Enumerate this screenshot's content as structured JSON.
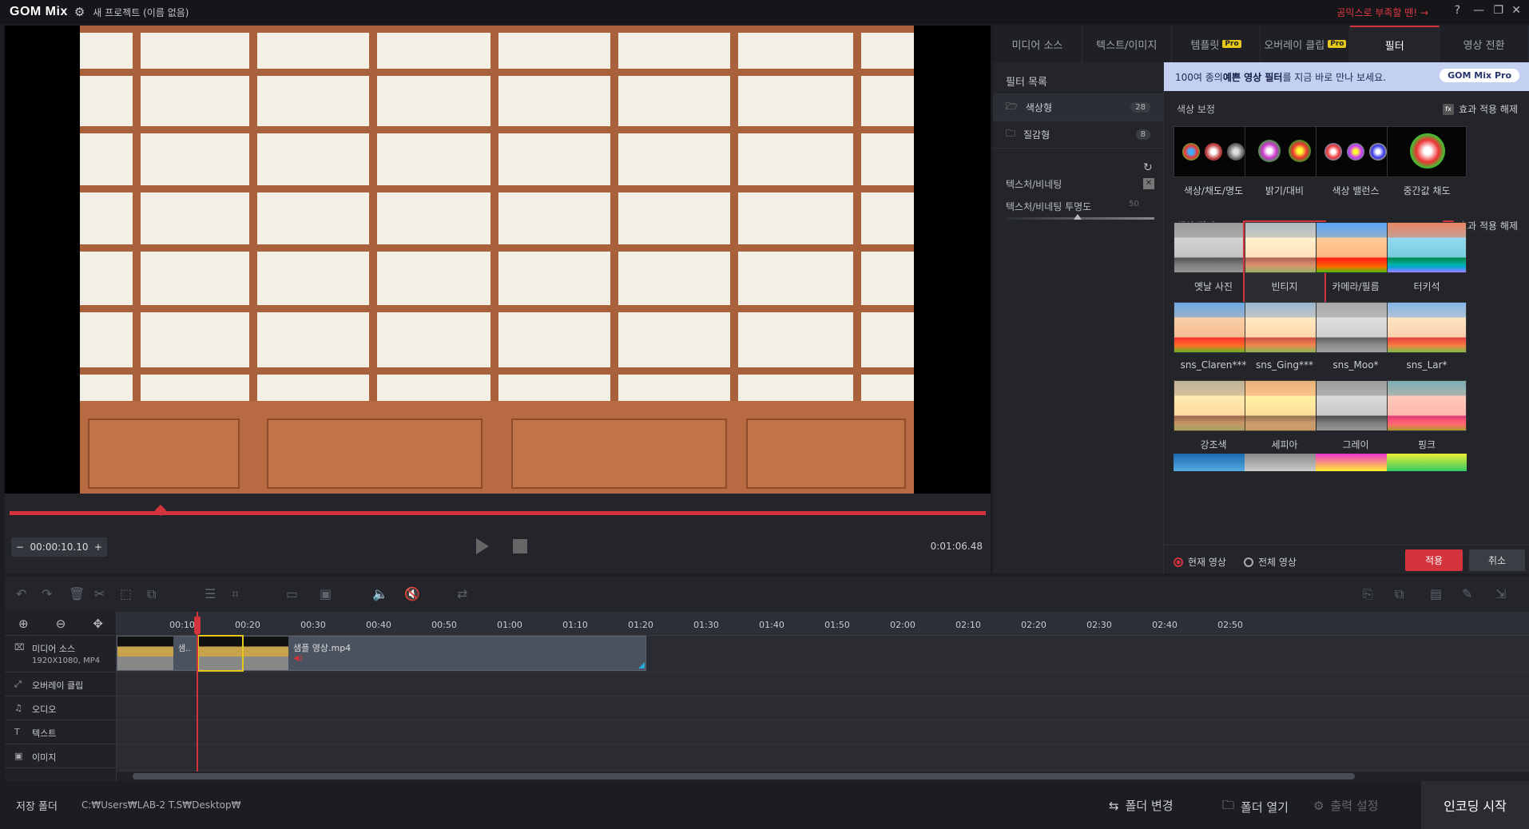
{
  "titlebar": {
    "logo": "GOM Mix",
    "project": "새 프로젝트 (이름 없음)",
    "promo": "곰믹스로 부족할 땐! →",
    "help": "?",
    "minimize": "—",
    "restore": "❐",
    "close": "✕"
  },
  "player": {
    "current_time": "00:00:10.10",
    "duration": "0:01:06.48",
    "progress": 0.155
  },
  "tabs": [
    {
      "label": "미디어 소스",
      "pro": ""
    },
    {
      "label": "텍스트/이미지",
      "pro": ""
    },
    {
      "label": "템플릿",
      "pro": "Pro"
    },
    {
      "label": "오버레이 클립",
      "pro": "Pro"
    },
    {
      "label": "필터",
      "pro": ""
    },
    {
      "label": "영상 전환",
      "pro": ""
    }
  ],
  "filter_list": {
    "header": "필터 목록",
    "categories": [
      {
        "label": "색상형",
        "count": "28"
      },
      {
        "label": "질감형",
        "count": "8"
      }
    ],
    "texture_label": "텍스처/비네팅",
    "texture_opacity_label": "텍스처/비네팅 투명도",
    "texture_opacity_value": "50"
  },
  "banner": {
    "pre": "100여 종의 ",
    "bold": "예쁜 영상 필터",
    "post": "를 지금 바로 만나 보세요.",
    "logo": "GOM Mix Pro"
  },
  "color_correction": {
    "title": "색상 보정",
    "reset": "효과 적용 해제",
    "items": [
      "색상/채도/명도",
      "밝기/대비",
      "색상 밸런스",
      "중간값 채도"
    ]
  },
  "color_filter": {
    "title": "색상 필터",
    "reset": "효과 적용 해제",
    "rows": [
      [
        "옛날 사진",
        "빈티지",
        "카메라/필름",
        "터키석"
      ],
      [
        "sns_Claren***",
        "sns_Ging***",
        "sns_Moo*",
        "sns_Lar*"
      ],
      [
        "강조색",
        "세피아",
        "그레이",
        "핑크"
      ]
    ],
    "selected": "빈티지"
  },
  "apply_row": {
    "current": "현재 영상",
    "all": "전체 영상",
    "apply": "적용",
    "cancel": "취소"
  },
  "timeline": {
    "ticks": [
      "00:10",
      "00:20",
      "00:30",
      "00:40",
      "00:50",
      "01:00",
      "01:10",
      "01:20",
      "01:30",
      "01:40",
      "01:50",
      "02:00",
      "02:10",
      "02:20",
      "02:30",
      "02:40",
      "02:50"
    ],
    "tracks": [
      {
        "label": "미디어 소스",
        "sub": "1920X1080, MP4"
      },
      {
        "label": "오버레이 클립",
        "sub": ""
      },
      {
        "label": "오디오",
        "sub": ""
      },
      {
        "label": "텍스트",
        "sub": ""
      },
      {
        "label": "이미지",
        "sub": ""
      }
    ],
    "clip_short": "샘..",
    "clip_name": "샘플 영상.mp4"
  },
  "footer": {
    "save_label": "저장 폴더",
    "path": "C:₩Users₩LAB-2 T.S₩Desktop₩",
    "change_folder": "폴더 변경",
    "open_folder": "폴더 열기",
    "output_settings": "출력 설정",
    "encode": "인코딩 시작"
  },
  "colors": {
    "accent": "#d3333c",
    "pro_badge": "#e5c91a",
    "banner_bg": "#c4d0f0"
  }
}
